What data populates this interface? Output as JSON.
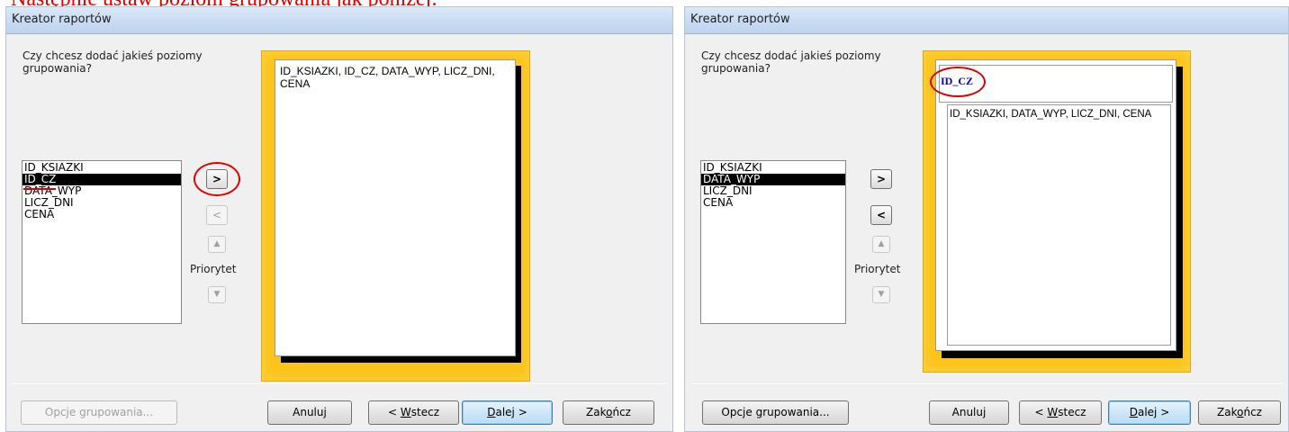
{
  "caption": "Następnie ustaw poziom grupowania jak poniżej:",
  "dialog_left": {
    "title": "Kreator raportów",
    "question": "Czy chcesz dodać jakieś poziomy grupowania?",
    "fields": [
      "ID_KSIAZKI",
      "ID_CZ",
      "DATA_WYP",
      "LICZ_DNI",
      "CENA"
    ],
    "selected_field": "ID_CZ",
    "add_arrow": ">",
    "remove_arrow": "<",
    "priority_label": "Priorytet",
    "preview_text": "ID_KSIAZKI, ID_CZ, DATA_WYP, LICZ_DNI, CENA",
    "buttons": {
      "grouping_options": "Opcje grupowania...",
      "cancel": "Anuluj",
      "back_prefix": "< ",
      "back_mnemonic": "W",
      "back_rest": "stecz",
      "next_mnemonic": "D",
      "next_rest": "alej >",
      "finish_prefix": "Zak",
      "finish_mnemonic": "o",
      "finish_rest": "ńcz"
    }
  },
  "dialog_right": {
    "title": "Kreator raportów",
    "question": "Czy chcesz dodać jakieś poziomy grupowania?",
    "fields": [
      "ID_KSIAZKI",
      "DATA_WYP",
      "LICZ_DNI",
      "CENA"
    ],
    "selected_field": "DATA_WYP",
    "add_arrow": ">",
    "remove_arrow": "<",
    "priority_label": "Priorytet",
    "group_level": "ID_CZ",
    "preview_text": "ID_KSIAZKI, DATA_WYP, LICZ_DNI, CENA",
    "buttons": {
      "grouping_options": "Opcje grupowania...",
      "cancel": "Anuluj",
      "back_prefix": "< ",
      "back_mnemonic": "W",
      "back_rest": "stecz",
      "next_mnemonic": "D",
      "next_rest": "alej >",
      "finish_prefix": "Zak",
      "finish_mnemonic": "o",
      "finish_rest": "ńcz"
    }
  },
  "icons": {
    "priority_up": "▲",
    "priority_down": "▼"
  },
  "colors": {
    "annotation_red": "#e00000",
    "preview_frame": "#fcc41a",
    "group_text": "#0000c8"
  }
}
